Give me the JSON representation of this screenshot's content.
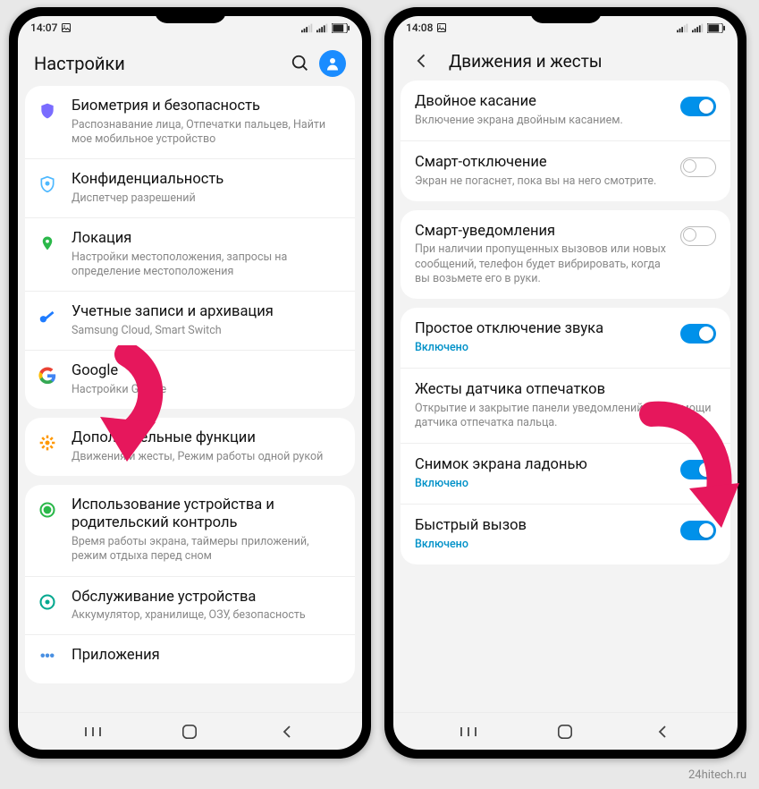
{
  "watermark": "24hitech.ru",
  "left": {
    "time": "14:07",
    "header_title": "Настройки",
    "items": [
      {
        "title": "Биометрия и безопасность",
        "sub": "Распознавание лица, Отпечатки пальцев, Найти мое мобильное устройство"
      },
      {
        "title": "Конфиденциальность",
        "sub": "Диспетчер разрешений"
      },
      {
        "title": "Локация",
        "sub": "Настройки местоположения, запросы на определение местоположения"
      },
      {
        "title": "Учетные записи и архивация",
        "sub": "Samsung Cloud, Smart Switch"
      },
      {
        "title": "Google",
        "sub": "Настройки Google"
      },
      {
        "title": "Дополнительные функции",
        "sub": "Движения и жесты, Режим работы одной рукой"
      },
      {
        "title": "Использование устройства и родительский контроль",
        "sub": "Время работы экрана, таймеры приложений, режим отдыха перед сном"
      },
      {
        "title": "Обслуживание устройства",
        "sub": "Аккумулятор, хранилище, ОЗУ, безопасность"
      },
      {
        "title": "Приложения",
        "sub": ""
      }
    ]
  },
  "right": {
    "time": "14:08",
    "header_title": "Движения и жесты",
    "items": [
      {
        "title": "Двойное касание",
        "sub": "Включение экрана двойным касанием.",
        "on": true
      },
      {
        "title": "Смарт-отключение",
        "sub": "Экран не погаснет, пока вы на него смотрите.",
        "on": false
      },
      {
        "title": "Смарт-уведомления",
        "sub": "При наличии пропущенных вызовов или новых сообщений, телефон будет вибрировать, когда вы возьмете его в руки.",
        "on": false
      },
      {
        "title": "Простое отключение звука",
        "sub": "Включено",
        "accent": true,
        "on": true
      },
      {
        "title": "Жесты датчика отпечатков",
        "sub": "Открытие и закрытие панели уведомлений при помощи датчика отпечатка пальца."
      },
      {
        "title": "Снимок экрана ладонью",
        "sub": "Включено",
        "accent": true,
        "on": true
      },
      {
        "title": "Быстрый вызов",
        "sub": "Включено",
        "accent": true,
        "on": true
      }
    ]
  }
}
